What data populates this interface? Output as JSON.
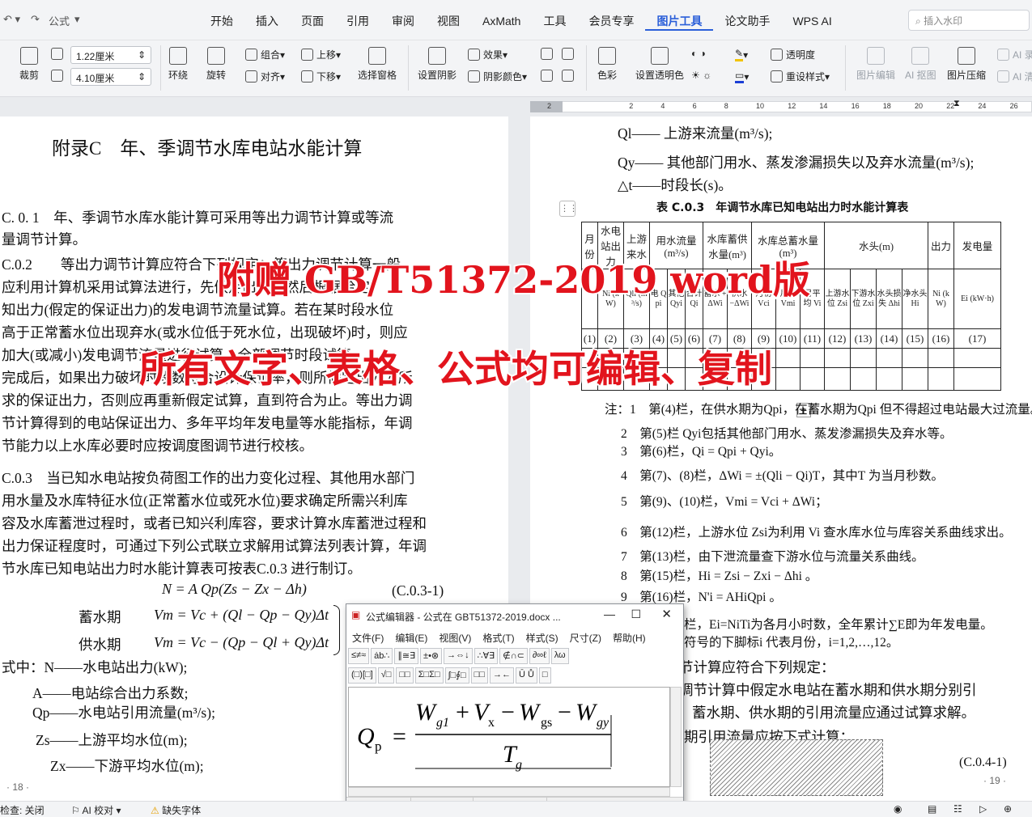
{
  "quick_access": {
    "redo_label": "公式"
  },
  "tabs": [
    "开始",
    "插入",
    "页面",
    "引用",
    "审阅",
    "视图",
    "AxMath",
    "工具",
    "会员专享",
    "图片工具",
    "论文助手",
    "WPS AI"
  ],
  "active_tab": "图片工具",
  "search": {
    "placeholder": "插入水印"
  },
  "ribbon": {
    "crop": "裁剪",
    "width_value": "1.22厘米",
    "height_value": "4.10厘米",
    "wrap": "环绕",
    "rotate": "旋转",
    "group": "组合",
    "align": "对齐",
    "bring_forward": "上移",
    "send_backward": "下移",
    "selection_pane": "选择窗格",
    "shadow_settings": "设置阴影",
    "effects": "效果",
    "shadow_color": "阴影颜色",
    "color": "色彩",
    "set_transparent": "设置透明色",
    "transparency": "透明度",
    "reset_style": "重设样式",
    "picture_edit": "图片编辑",
    "ai_cutout": "AI 抠图",
    "compress": "图片压缩",
    "ai_1": "AI 录",
    "ai_2": "AI 清"
  },
  "ruler_ticks": [
    "2",
    "2",
    "4",
    "6",
    "8",
    "10",
    "12",
    "14",
    "16",
    "18",
    "20",
    "22",
    "24",
    "26",
    "28"
  ],
  "left_page": {
    "title": "附录C　年、季调节水库电站水能计算",
    "lines": [
      "C. 0. 1　年、季调节水库水能计算可采用等出力调节计算或等流",
      "量调节计算。",
      "C.0.2　　等出力调节计算应符合下列规定：等出力调节计算一般",
      "应利用计算机采用试算法进行，先假定出力，然后根据给定",
      "知出力(假定的保证出力)的发电调节流量试算。若在某时段水位",
      "高于正常蓄水位出现弃水(或水位低于死水位，出现破坏)时，则应",
      "加大(或减小)发电调节流量进行试算。全部调节时段试算",
      "完成后，如果出力破坏时段数符合设计保证率，则所假定出力为所",
      "求的保证出力，否则应再重新假定试算，直到符合为止。等出力调",
      "节计算得到的电站保证出力、多年平均年发电量等水能指标，年调",
      "节能力以上水库必要时应按调度图调节进行校核。",
      "C.0.3　当已知水电站按负荷图工作的出力变化过程、其他用水部门",
      "用水量及水库特征水位(正常蓄水位或死水位)要求确定所需兴利库",
      "容及水库蓄泄过程时，或者已知兴利库容，要求计算水库蓄泄过程和",
      "出力保证程度时，可通过下列公式联立求解用试算法列表计算，年调",
      "节水库已知电站出力时水能计算表可按表C.0.3 进行制订。"
    ],
    "eq_main": "N = A Qp(Zs − Zx − Δh)",
    "eq_main_no": "(C.0.3-1)",
    "storage_label": "蓄水期",
    "eq_storage": "Vm = Vc + (Ql − Qp − Qy)Δt",
    "supply_label": "供水期",
    "eq_supply": "Vm = Vc − (Qp − Ql + Qy)Δt",
    "defs": [
      "式中：N——水电站出力(kW);",
      "A——电站综合出力系数;",
      "Qp——水电站引用流量(m³/s);",
      "Zs——上游平均水位(m);",
      "Zx——下游平均水位(m);"
    ],
    "page_no": "18"
  },
  "right_page": {
    "top_lines": [
      "Ql—— 上游来流量(m³/s);",
      "Qy—— 其他部门用水、蒸发渗漏损失以及弃水流量(m³/s);",
      "△t——时段长(s)。"
    ],
    "table_caption": "表 C.0.3　年调节水库已知电站出力时水能计算表",
    "table_headers": [
      "月份",
      "水电站出力",
      "上游来水",
      "用水流量(m³/s)",
      "水库蓄供水量(m³)",
      "水库总蓄水量(m³)",
      "水头(m)",
      "出力",
      "发电量"
    ],
    "table_subheaders": [
      "Ni (kW)",
      "Qli (m³/s)",
      "电 Qpi",
      "其他 Qyi",
      "合计 Qi",
      "蓄水 +ΔWi",
      "供水 −ΔWi",
      "月初 Vci",
      "月末 Vmi",
      "月平均 Vi",
      "上游水位 Zsi",
      "下游水位 Zxi",
      "水头损失 Δhi",
      "净水头 Hi",
      "Ni (kW)",
      "Ei (kW·h)"
    ],
    "col_numbers": [
      "(1)",
      "(2)",
      "(3)",
      "(4)",
      "(5)",
      "(6)",
      "(7)",
      "(8)",
      "(9)",
      "(10)",
      "(11)",
      "(12)",
      "(13)",
      "(14)",
      "(15)",
      "(16)",
      "(17)"
    ],
    "notes": [
      "注：1　第(4)栏，在供水期为Qpi，在蓄水期为Qpi 但不得超过电站最大过流量。",
      "2　第(5)栏 Qyi包括其他部门用水、蒸发渗漏损失及弃水等。",
      "3　第(6)栏，Qi = Qpi + Qyi。",
      "4　第(7)、(8)栏，ΔWi = ±(Qli − Qi)T，其中T 为当月秒数。",
      "5　第(9)、(10)栏，Vmi = Vci + ΔWi；",
      "6　第(12)栏，上游水位 Zsi为利用 Vi 查水库水位与库容关系曲线求出。",
      "7　第(13)栏，由下泄流量查下游水位与流量关系曲线。",
      "8　第(15)栏，Hi = Zsi − Zxi − Δhi 。",
      "9　第(16)栏，N'i = AHiQpi 。",
      "栏，Ei=NiTi为各月小时数，全年累计∑E即为年发电量。",
      "符号的下脚标i 代表月份，i=1,2,…,12。",
      "节计算应符合下列规定：",
      "调节计算中假定水电站在蓄水期和供水期分别引",
      "蓄水期、供水期的引用流量应通过试算求解。",
      "期引用流量应按下式计算："
    ],
    "eq_no": "(C.0.4-1)",
    "page_no": "19"
  },
  "overlay": {
    "line1": "附赠 GB/T51372-2019 word版",
    "line2": "所有文字、表格、公式均可编辑、复制"
  },
  "formula_editor": {
    "title": "公式编辑器 - 公式在 GBT51372-2019.docx ...",
    "menu": [
      "文件(F)",
      "编辑(E)",
      "视图(V)",
      "格式(T)",
      "样式(S)",
      "尺寸(Z)",
      "帮助(H)"
    ],
    "palette_row1": [
      "≤≠≈",
      "ȧb∴",
      "∥≅∃",
      "±•⊗",
      "→⇔↓",
      "∴∀∃",
      "∉∩⊂",
      "∂∞ℓ",
      "λω"
    ],
    "palette_row2": [
      "(□)[□]",
      "√□",
      "□□",
      "Σ□Σ□",
      "∫□∮□",
      "□□",
      "→←",
      "Ū Ů",
      "□"
    ],
    "formula": "Qp = (Wg1 + Vx − Wgs − Wgy) / Tg",
    "status": [
      "样式: 数学(M)",
      "尺寸: 标准(F)",
      "显示比例: 200%"
    ]
  },
  "statusbar": {
    "left": "检查: 关闭",
    "ai_check": "AI 校对",
    "missing_font": "缺失字体"
  }
}
